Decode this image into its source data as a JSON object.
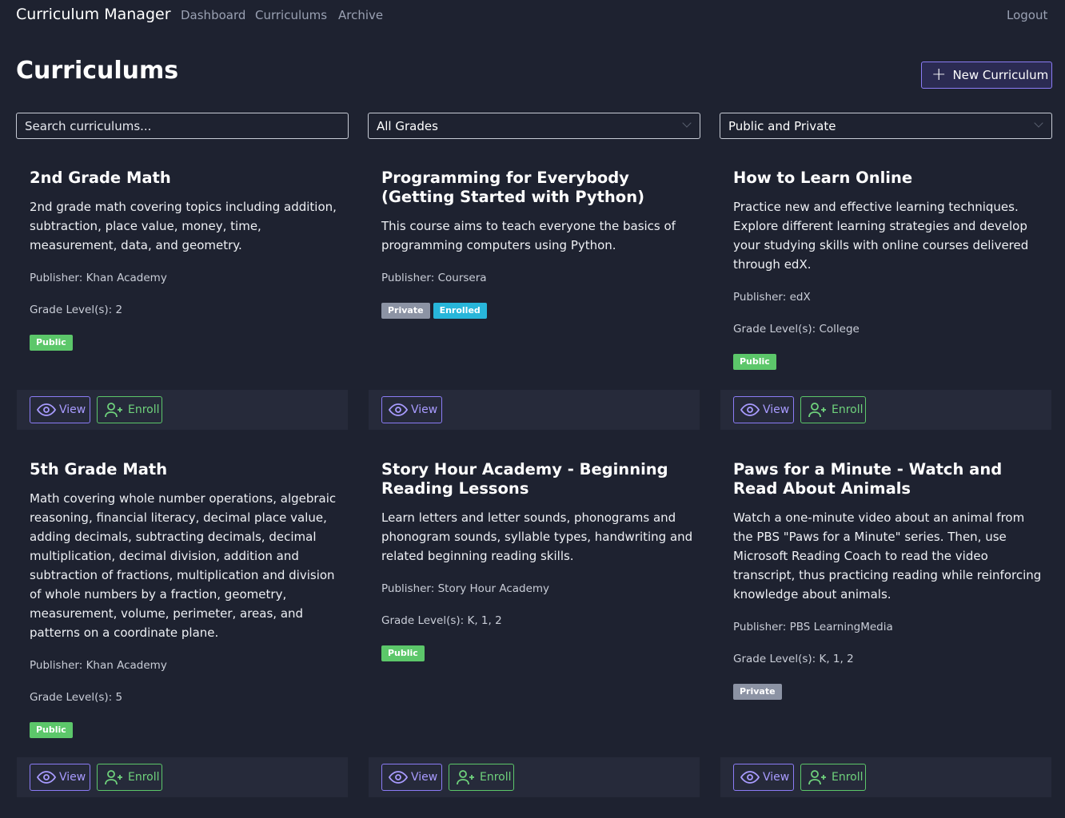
{
  "nav": {
    "brand": "Curriculum Manager",
    "links": [
      "Dashboard",
      "Curriculums",
      "Archive"
    ],
    "logout": "Logout"
  },
  "page": {
    "title": "Curriculums",
    "new_button": "New Curriculum"
  },
  "filters": {
    "search_placeholder": "Search curriculums...",
    "grade": "All Grades",
    "visibility": "Public and Private"
  },
  "labels": {
    "view": "View",
    "enroll": "Enroll"
  },
  "cards": [
    {
      "title": "2nd Grade Math",
      "description": "2nd grade math covering topics including addition, subtraction, place value, money, time, measurement, data, and geometry.",
      "publisher": "Publisher: Khan Academy",
      "grades": "Grade Level(s): 2",
      "badges": [
        "Public"
      ]
    },
    {
      "title": "Programming for Everybody (Getting Started with Python)",
      "description": "This course aims to teach everyone the basics of programming computers using Python.",
      "publisher": "Publisher: Coursera",
      "grades": "",
      "badges": [
        "Private",
        "Enrolled"
      ]
    },
    {
      "title": "How to Learn Online",
      "description": "Practice new and effective learning techniques. Explore different learning strategies and develop your studying skills with online courses delivered through edX.",
      "publisher": "Publisher: edX",
      "grades": "Grade Level(s): College",
      "badges": [
        "Public"
      ]
    },
    {
      "title": "5th Grade Math",
      "description": "Math covering whole number operations, algebraic reasoning, financial literacy, decimal place value, adding decimals, subtracting decimals, decimal multiplication, decimal division, addition and subtraction of fractions, multiplication and division of whole numbers by a fraction, geometry, measurement, volume, perimeter, areas, and patterns on a coordinate plane.",
      "publisher": "Publisher: Khan Academy",
      "grades": "Grade Level(s): 5",
      "badges": [
        "Public"
      ]
    },
    {
      "title": "Story Hour Academy - Beginning Reading Lessons",
      "description": "Learn letters and letter sounds, phonograms and phonogram sounds, syllable types, handwriting and related beginning reading skills.",
      "publisher": "Publisher: Story Hour Academy",
      "grades": "Grade Level(s): K, 1, 2",
      "badges": [
        "Public"
      ]
    },
    {
      "title": "Paws for a Minute - Watch and Read About Animals",
      "description": "Watch a one-minute video about an animal from the PBS \"Paws for a Minute\" series. Then, use Microsoft Reading Coach to read the video transcript, thus practicing reading while reinforcing knowledge about animals.",
      "publisher": "Publisher: PBS LearningMedia",
      "grades": "Grade Level(s): K, 1, 2",
      "badges": [
        "Private"
      ]
    }
  ]
}
